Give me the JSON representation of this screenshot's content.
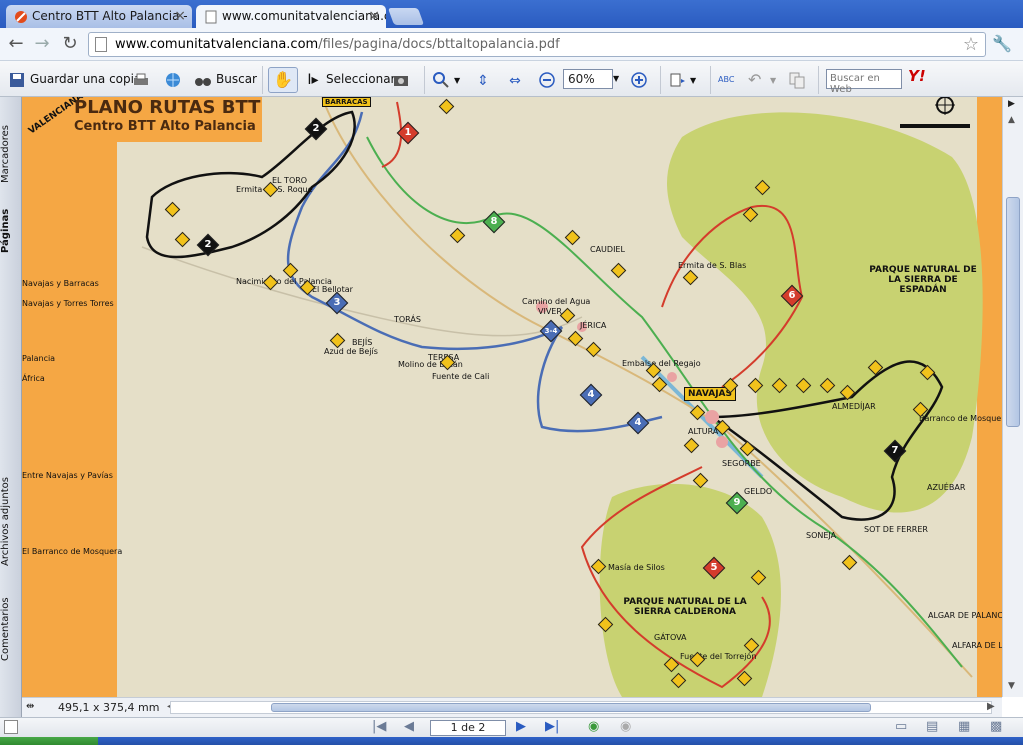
{
  "tabs": [
    {
      "label": "Centro BTT Alto Palancia - Poi",
      "active": false
    },
    {
      "label": "www.comunitatvalenciana.co",
      "active": true
    }
  ],
  "omnibox": {
    "host": "www.comunitatvalenciana.com",
    "path": "/files/pagina/docs/bttaltopalancia.pdf"
  },
  "pdf_toolbar": {
    "save_copy": "Guardar una copia",
    "search": "Buscar",
    "select": "Seleccionar",
    "zoom": "60%",
    "web_search_placeholder": "Buscar en Web"
  },
  "left_tabs": [
    "Marcadores",
    "Páginas",
    "Archivos adjuntos",
    "Comentarios"
  ],
  "page_dims": "495,1 x 375,4 mm",
  "page_nav": "1 de 2",
  "map": {
    "header_line1": "PLANO RUTAS BTT",
    "header_line2": "Centro BTT Alto Palancia",
    "corner_text": "VALENCIANA",
    "left_list": [
      "Navajas y Barracas",
      "Navajas y Torres Torres",
      "Palancia",
      "África",
      "Entre Navajas y Pavías",
      "El Barranco de Mosquera"
    ],
    "park1": "PARQUE NATURAL DE LA SIERRA DE ESPADÁN",
    "park2": "PARQUE NATURAL DE LA SIERRA CALDERONA",
    "navajas": "NAVAJAS",
    "barracas": "BARRACAS",
    "routes": [
      "1",
      "2",
      "2",
      "3",
      "3-4",
      "4",
      "4",
      "5",
      "6",
      "7",
      "8",
      "9"
    ],
    "places": [
      "EL TORO",
      "Ermita de S. Roque",
      "El Bellotar",
      "Nacimiento del Palancia",
      "Azud de Bejís",
      "BEJÍS",
      "TORÁS",
      "TERESA",
      "VIVER",
      "Camino del Agua",
      "JÉRICA",
      "Fuente de Cali",
      "Molino de Batán",
      "Ermita de S. Blas",
      "CAUDIEL",
      "Embalse del Regajo",
      "ALMEDÍJAR",
      "Barranco de Mosquera",
      "AZUÉBAR",
      "ALTURA",
      "SEGORBE",
      "GELDO",
      "SONEJA",
      "SOT DE FERRER",
      "Masía de Silos",
      "GÁTOVA",
      "Fuente del Torrejón",
      "ALGAR DE PALANCIA",
      "ALFARA DE LA BARONÍA"
    ]
  }
}
